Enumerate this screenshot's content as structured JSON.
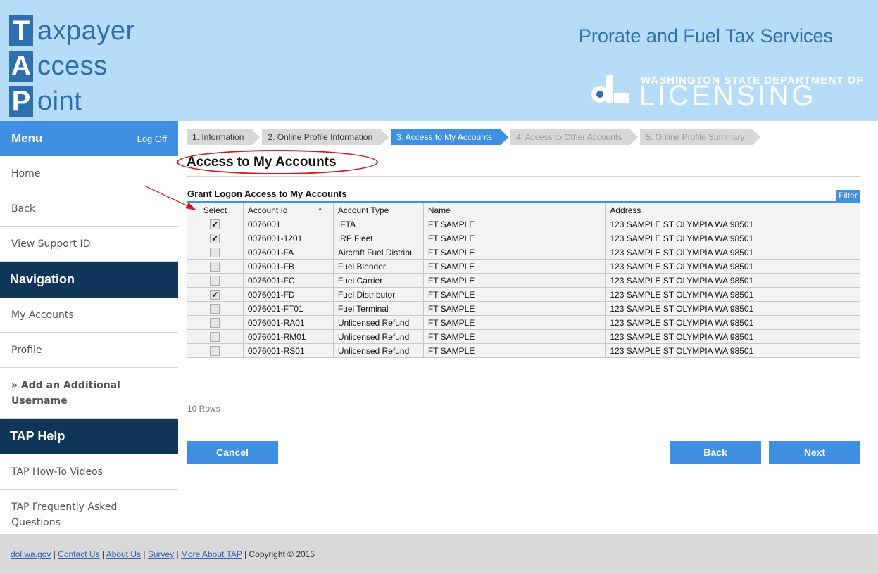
{
  "header": {
    "tap": [
      {
        "letter": "T",
        "rest": "axpayer"
      },
      {
        "letter": "A",
        "rest": "ccess"
      },
      {
        "letter": "P",
        "rest": "oint"
      }
    ],
    "title": "Prorate and Fuel Tax Services",
    "agency_small": "WASHINGTON STATE DEPARTMENT OF",
    "agency_big": "LICENSING"
  },
  "sidebar": {
    "menu_title": "Menu",
    "logoff": "Log Off",
    "menu_items": [
      "Home",
      "Back",
      "View Support ID"
    ],
    "navigation_title": "Navigation",
    "navigation_items": [
      "My Accounts",
      "Profile",
      "» Add an Additional Username"
    ],
    "help_title": "TAP Help",
    "help_items": [
      "TAP How-To Videos",
      "TAP Frequently Asked Questions"
    ]
  },
  "steps": [
    "1. Information",
    "2. Online Profile Information",
    "3. Access to My Accounts",
    "4. Access to Other Accounts",
    "5. Online Profile Summary"
  ],
  "active_step": 3,
  "page_title": "Access to My Accounts",
  "grid": {
    "title": "Grant Logon Access to My Accounts",
    "filter_label": "Filter",
    "columns": [
      "Select",
      "Account Id",
      "Account Type",
      "Name",
      "Address"
    ],
    "rows": [
      {
        "selected": true,
        "account_id": "0076001",
        "account_type": "IFTA",
        "name": "FT SAMPLE",
        "address": "123 SAMPLE ST OLYMPIA WA 98501"
      },
      {
        "selected": true,
        "account_id": "0076001-1201",
        "account_type": "IRP Fleet",
        "name": "FT SAMPLE",
        "address": "123 SAMPLE ST OLYMPIA WA 98501"
      },
      {
        "selected": false,
        "account_id": "0076001-FA",
        "account_type": "Aircraft Fuel Distribı",
        "name": "FT SAMPLE",
        "address": "123 SAMPLE ST OLYMPIA WA 98501"
      },
      {
        "selected": false,
        "account_id": "0076001-FB",
        "account_type": "Fuel Blender",
        "name": "FT SAMPLE",
        "address": "123 SAMPLE ST OLYMPIA WA 98501"
      },
      {
        "selected": false,
        "account_id": "0076001-FC",
        "account_type": "Fuel Carrier",
        "name": "FT SAMPLE",
        "address": "123 SAMPLE ST OLYMPIA WA 98501"
      },
      {
        "selected": true,
        "account_id": "0076001-FD",
        "account_type": "Fuel Distributor",
        "name": "FT SAMPLE",
        "address": "123 SAMPLE ST OLYMPIA WA 98501"
      },
      {
        "selected": false,
        "account_id": "0076001-FT01",
        "account_type": "Fuel Terminal",
        "name": "FT SAMPLE",
        "address": "123 SAMPLE ST OLYMPIA WA 98501"
      },
      {
        "selected": false,
        "account_id": "0076001-RA01",
        "account_type": "Unlicensed Refund",
        "name": "FT SAMPLE",
        "address": "123 SAMPLE ST OLYMPIA WA 98501"
      },
      {
        "selected": false,
        "account_id": "0076001-RM01",
        "account_type": "Unlicensed Refund",
        "name": "FT SAMPLE",
        "address": "123 SAMPLE ST OLYMPIA WA 98501"
      },
      {
        "selected": false,
        "account_id": "0076001-RS01",
        "account_type": "Unlicensed Refund",
        "name": "FT SAMPLE",
        "address": "123 SAMPLE ST OLYMPIA WA 98501"
      }
    ],
    "rows_count": "10 Rows"
  },
  "buttons": {
    "cancel": "Cancel",
    "back": "Back",
    "next": "Next"
  },
  "footer": {
    "links": [
      "dol.wa.gov",
      "Contact Us",
      "About Us",
      "Survey",
      "More About TAP"
    ],
    "copyright": "Copyright © 2015"
  },
  "colors": {
    "header_bg": "#b7dcf7",
    "brand_blue": "#2e6fae",
    "accent_blue": "#3f8fe2",
    "nav_dark": "#0f3658",
    "annotation_red": "#d9141b"
  }
}
